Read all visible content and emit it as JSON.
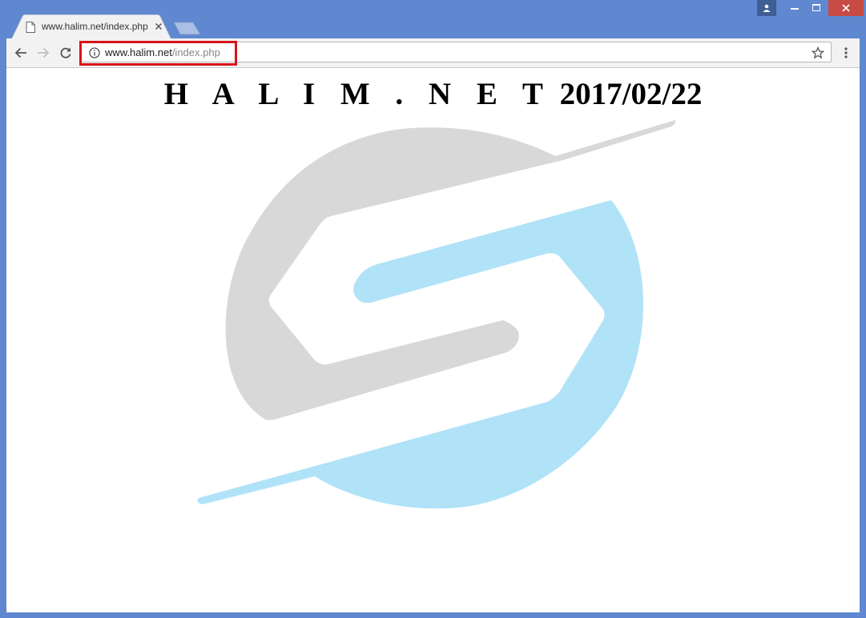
{
  "browser": {
    "tab": {
      "title": "www.halim.net/index.php"
    },
    "address_bar": {
      "host": "www.halim.net",
      "path": "/index.php"
    }
  },
  "page": {
    "brand": "H A L I M . N E T",
    "date": "2017/02/22"
  },
  "colors": {
    "frame": "#5f88d0",
    "close": "#c84a44",
    "highlight": "#d8141b",
    "logo_gray": "#d8d8d8",
    "logo_blue": "#b0e2f8"
  },
  "icons": [
    "profile-icon",
    "minimize-icon",
    "maximize-icon",
    "close-icon",
    "page-icon",
    "tab-close-icon",
    "back-arrow-icon",
    "forward-arrow-icon",
    "reload-icon",
    "info-icon",
    "star-icon",
    "menu-dots-icon"
  ]
}
